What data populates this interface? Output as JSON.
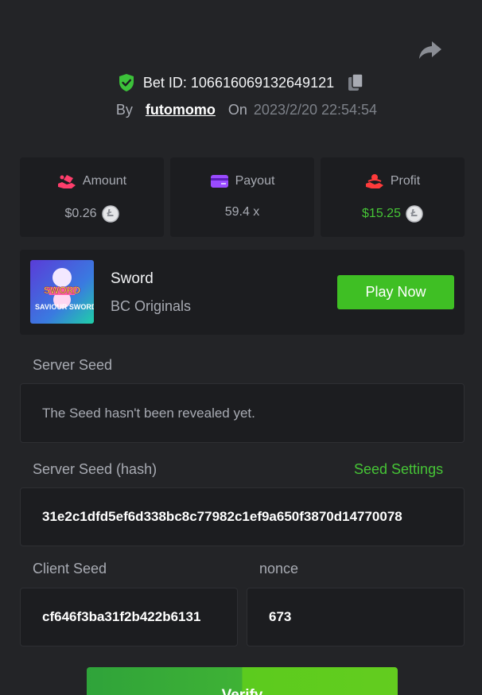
{
  "header": {
    "bet_id_label": "Bet ID:",
    "bet_id_value": "106616069132649121",
    "by_label": "By",
    "username": "futomomo",
    "on_label": "On",
    "datetime": "2023/2/20 22:54:54"
  },
  "stats": {
    "amount": {
      "label": "Amount",
      "value": "$0.26",
      "icon": "amount-hand-icon"
    },
    "payout": {
      "label": "Payout",
      "value": "59.4 x",
      "icon": "card-icon"
    },
    "profit": {
      "label": "Profit",
      "value": "$15.25",
      "icon": "profit-hand-icon"
    }
  },
  "game": {
    "name": "Sword",
    "provider": "BC Originals",
    "thumb_text_top": "SWORD",
    "thumb_text_bottom": "SAVIOUR SWORD",
    "play_label": "Play Now"
  },
  "server_seed": {
    "label": "Server Seed",
    "placeholder": "The Seed hasn't been revealed yet."
  },
  "server_seed_hash": {
    "label": "Server Seed (hash)",
    "settings_label": "Seed Settings",
    "value": "31e2c1dfd5ef6d338bc8c77982c1ef9a650f3870d14770078"
  },
  "client_seed": {
    "label": "Client Seed",
    "value": "cf646f3ba31f2b422b6131"
  },
  "nonce": {
    "label": "nonce",
    "value": "673"
  },
  "verify_label": "Verify",
  "colors": {
    "accent_green": "#46c536",
    "background": "#232427",
    "card": "#1c1d20"
  }
}
